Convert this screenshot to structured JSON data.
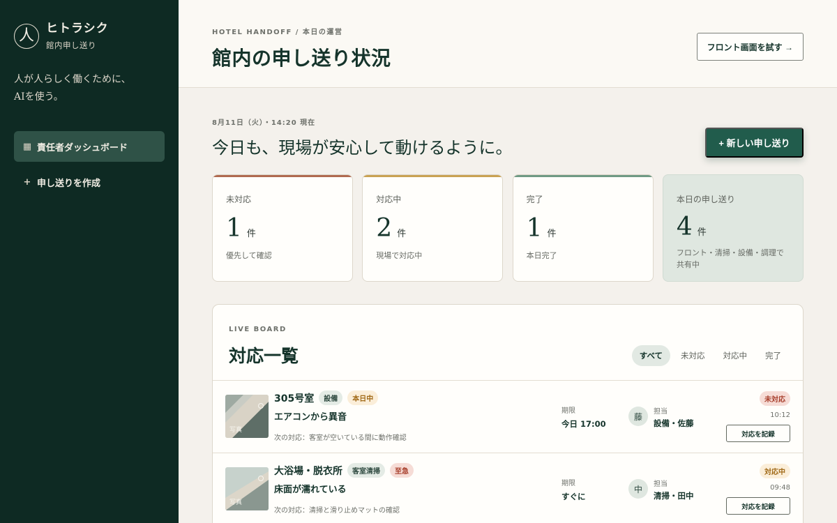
{
  "brand": {
    "mark": "人",
    "name": "ヒトラシク",
    "subtitle": "館内申し送り"
  },
  "tagline": [
    "人が人らしく働くために、",
    "AIを使う。"
  ],
  "nav": [
    {
      "icon": "grid-icon",
      "glyph": "▦",
      "label": "責任者ダッシュボード",
      "active": true
    },
    {
      "icon": "plus-icon",
      "glyph": "+",
      "label": "申し送りを作成",
      "active": false
    }
  ],
  "header": {
    "breadcrumb": "HOTEL HANDOFF / 本日の運営",
    "title": "館内の申し送り状況",
    "front_button": "フロント画面を試す →"
  },
  "main": {
    "date_line": "8月11日（火）・14:20 現在",
    "hero": "今日も、現場が安心して動けるように。",
    "new_button": "+ 新しい申し送り"
  },
  "colors": {
    "open": "#b06a50",
    "in_progress": "#c9a253",
    "done": "#6f9a84",
    "primary": "#215c4c",
    "sidebar": "#0e2a23"
  },
  "cards": [
    {
      "label": "未対応",
      "count": "1",
      "unit": "件",
      "note": "優先して確認",
      "accent": "#b06a50"
    },
    {
      "label": "対応中",
      "count": "2",
      "unit": "件",
      "note": "現場で対応中",
      "accent": "#c9a253"
    },
    {
      "label": "完了",
      "count": "1",
      "unit": "件",
      "note": "本日完了",
      "accent": "#6f9a84"
    },
    {
      "label": "本日の申し送り",
      "count": "4",
      "unit": "件",
      "note": "フロント・清掃・設備・調理で共有中",
      "accent": ""
    }
  ],
  "board": {
    "eyebrow": "LIVE BOARD",
    "title": "対応一覧",
    "filters": [
      {
        "label": "すべて",
        "active": true
      },
      {
        "label": "未対応",
        "active": false
      },
      {
        "label": "対応中",
        "active": false
      },
      {
        "label": "完了",
        "active": false
      }
    ],
    "due_label": "期限",
    "owner_label": "担当",
    "record_label": "対応を記録",
    "photo_label": "写真",
    "rows": [
      {
        "location": "305号室",
        "category": "設備",
        "tag": "本日中",
        "tag_type": "today",
        "issue": "エアコンから異音",
        "next": "次の対応：客室が空いている間に動作確認",
        "due": "今日 17:00",
        "avatar": "藤",
        "owner": "設備・佐藤",
        "status": "未対応",
        "status_type": "open",
        "time": "10:12"
      },
      {
        "location": "大浴場・脱衣所",
        "category": "客室清掃",
        "tag": "至急",
        "tag_type": "urgent",
        "issue": "床面が濡れている",
        "next": "次の対応：清掃と滑り止めマットの確認",
        "due": "すぐに",
        "avatar": "中",
        "owner": "清掃・田中",
        "status": "対応中",
        "status_type": "progress",
        "time": "09:48"
      }
    ]
  }
}
